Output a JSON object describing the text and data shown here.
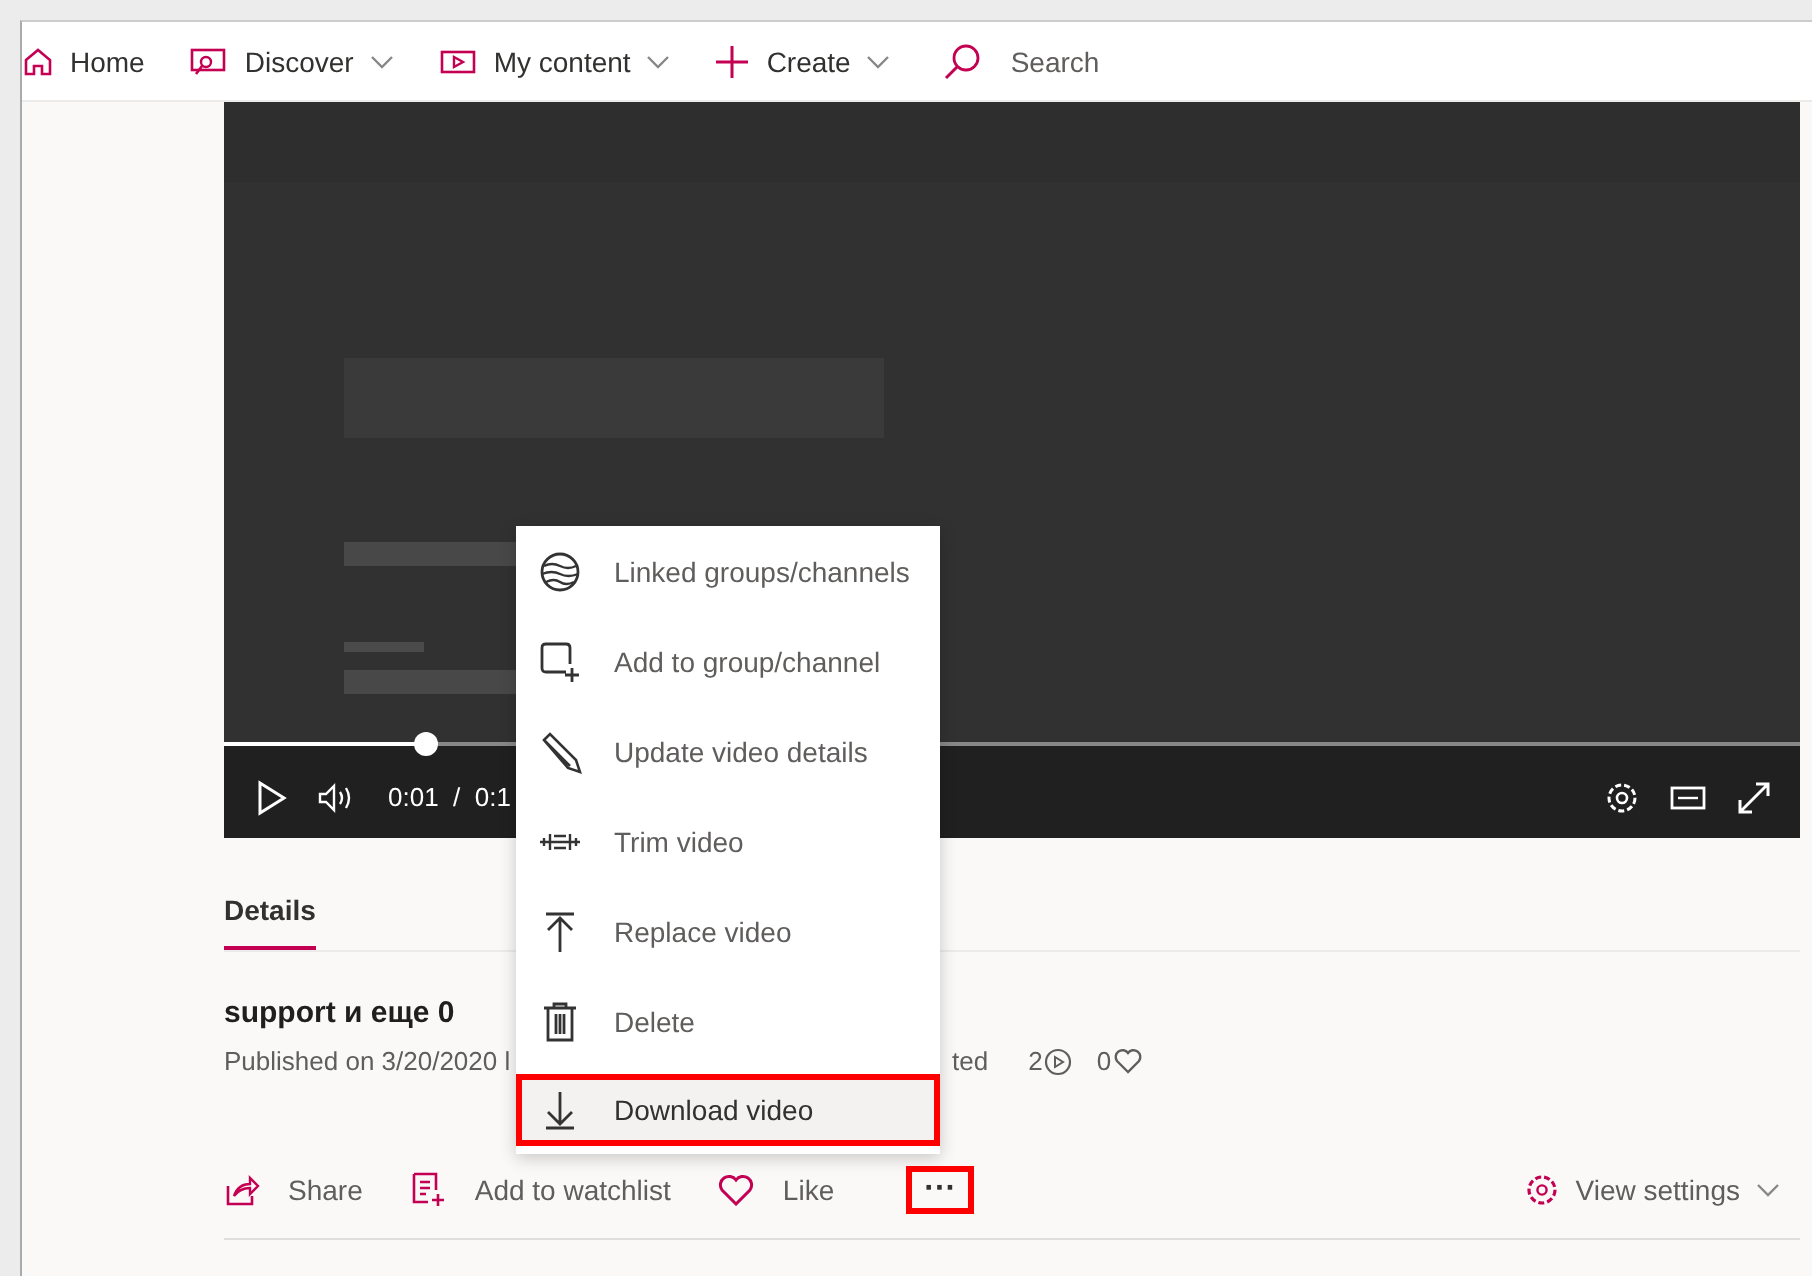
{
  "nav": {
    "items": [
      {
        "label": "Home",
        "has_menu": false
      },
      {
        "label": "Discover",
        "has_menu": true
      },
      {
        "label": "My content",
        "has_menu": true
      },
      {
        "label": "Create",
        "has_menu": true
      }
    ],
    "search": {
      "placeholder": "Search"
    }
  },
  "player": {
    "progress": {
      "level": 0.128
    },
    "time": "0:01  /  0:1"
  },
  "tabs": [
    {
      "label": "Details",
      "selected": true
    }
  ],
  "video": {
    "title": "support и еще 0",
    "meta_left": "Published on 3/20/2020 l",
    "meta_right": "ted",
    "views": "2",
    "likes": "0"
  },
  "actions": [
    {
      "label": "Share"
    },
    {
      "label": "Add to watchlist"
    },
    {
      "label": "Like"
    }
  ],
  "more_button": {
    "label": "···",
    "highlighted": true
  },
  "view_settings": {
    "label": "View settings"
  },
  "menu": [
    {
      "label": "Linked groups/channels",
      "highlighted": false
    },
    {
      "label": "Add to group/channel",
      "highlighted": false
    },
    {
      "label": "Update video details",
      "highlighted": false
    },
    {
      "label": "Trim video",
      "highlighted": false
    },
    {
      "label": "Replace video",
      "highlighted": false
    },
    {
      "label": "Delete",
      "highlighted": false
    },
    {
      "label": "Download video",
      "highlighted": true
    }
  ]
}
